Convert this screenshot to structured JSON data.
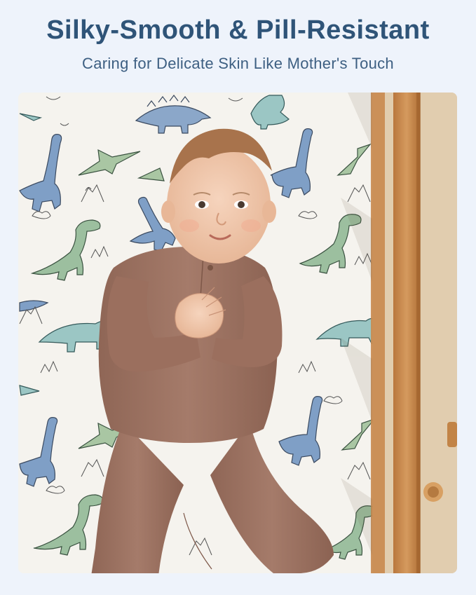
{
  "header": {
    "title": "Silky-Smooth & Pill-Resistant",
    "subtitle": "Caring for Delicate Skin Like Mother's Touch"
  },
  "colors": {
    "background": "#eef3fb",
    "title_text": "#2f5478",
    "subtitle_text": "#3d5f82",
    "dino_blue": "#7f9fc6",
    "dino_green": "#9cbf9f",
    "dino_teal": "#9bc6c4",
    "crib_wood": "#c98a4f",
    "romper": "#9c7262"
  },
  "photo": {
    "subject": "baby-in-crib-icon",
    "pattern": "dinosaur-print-icon"
  }
}
